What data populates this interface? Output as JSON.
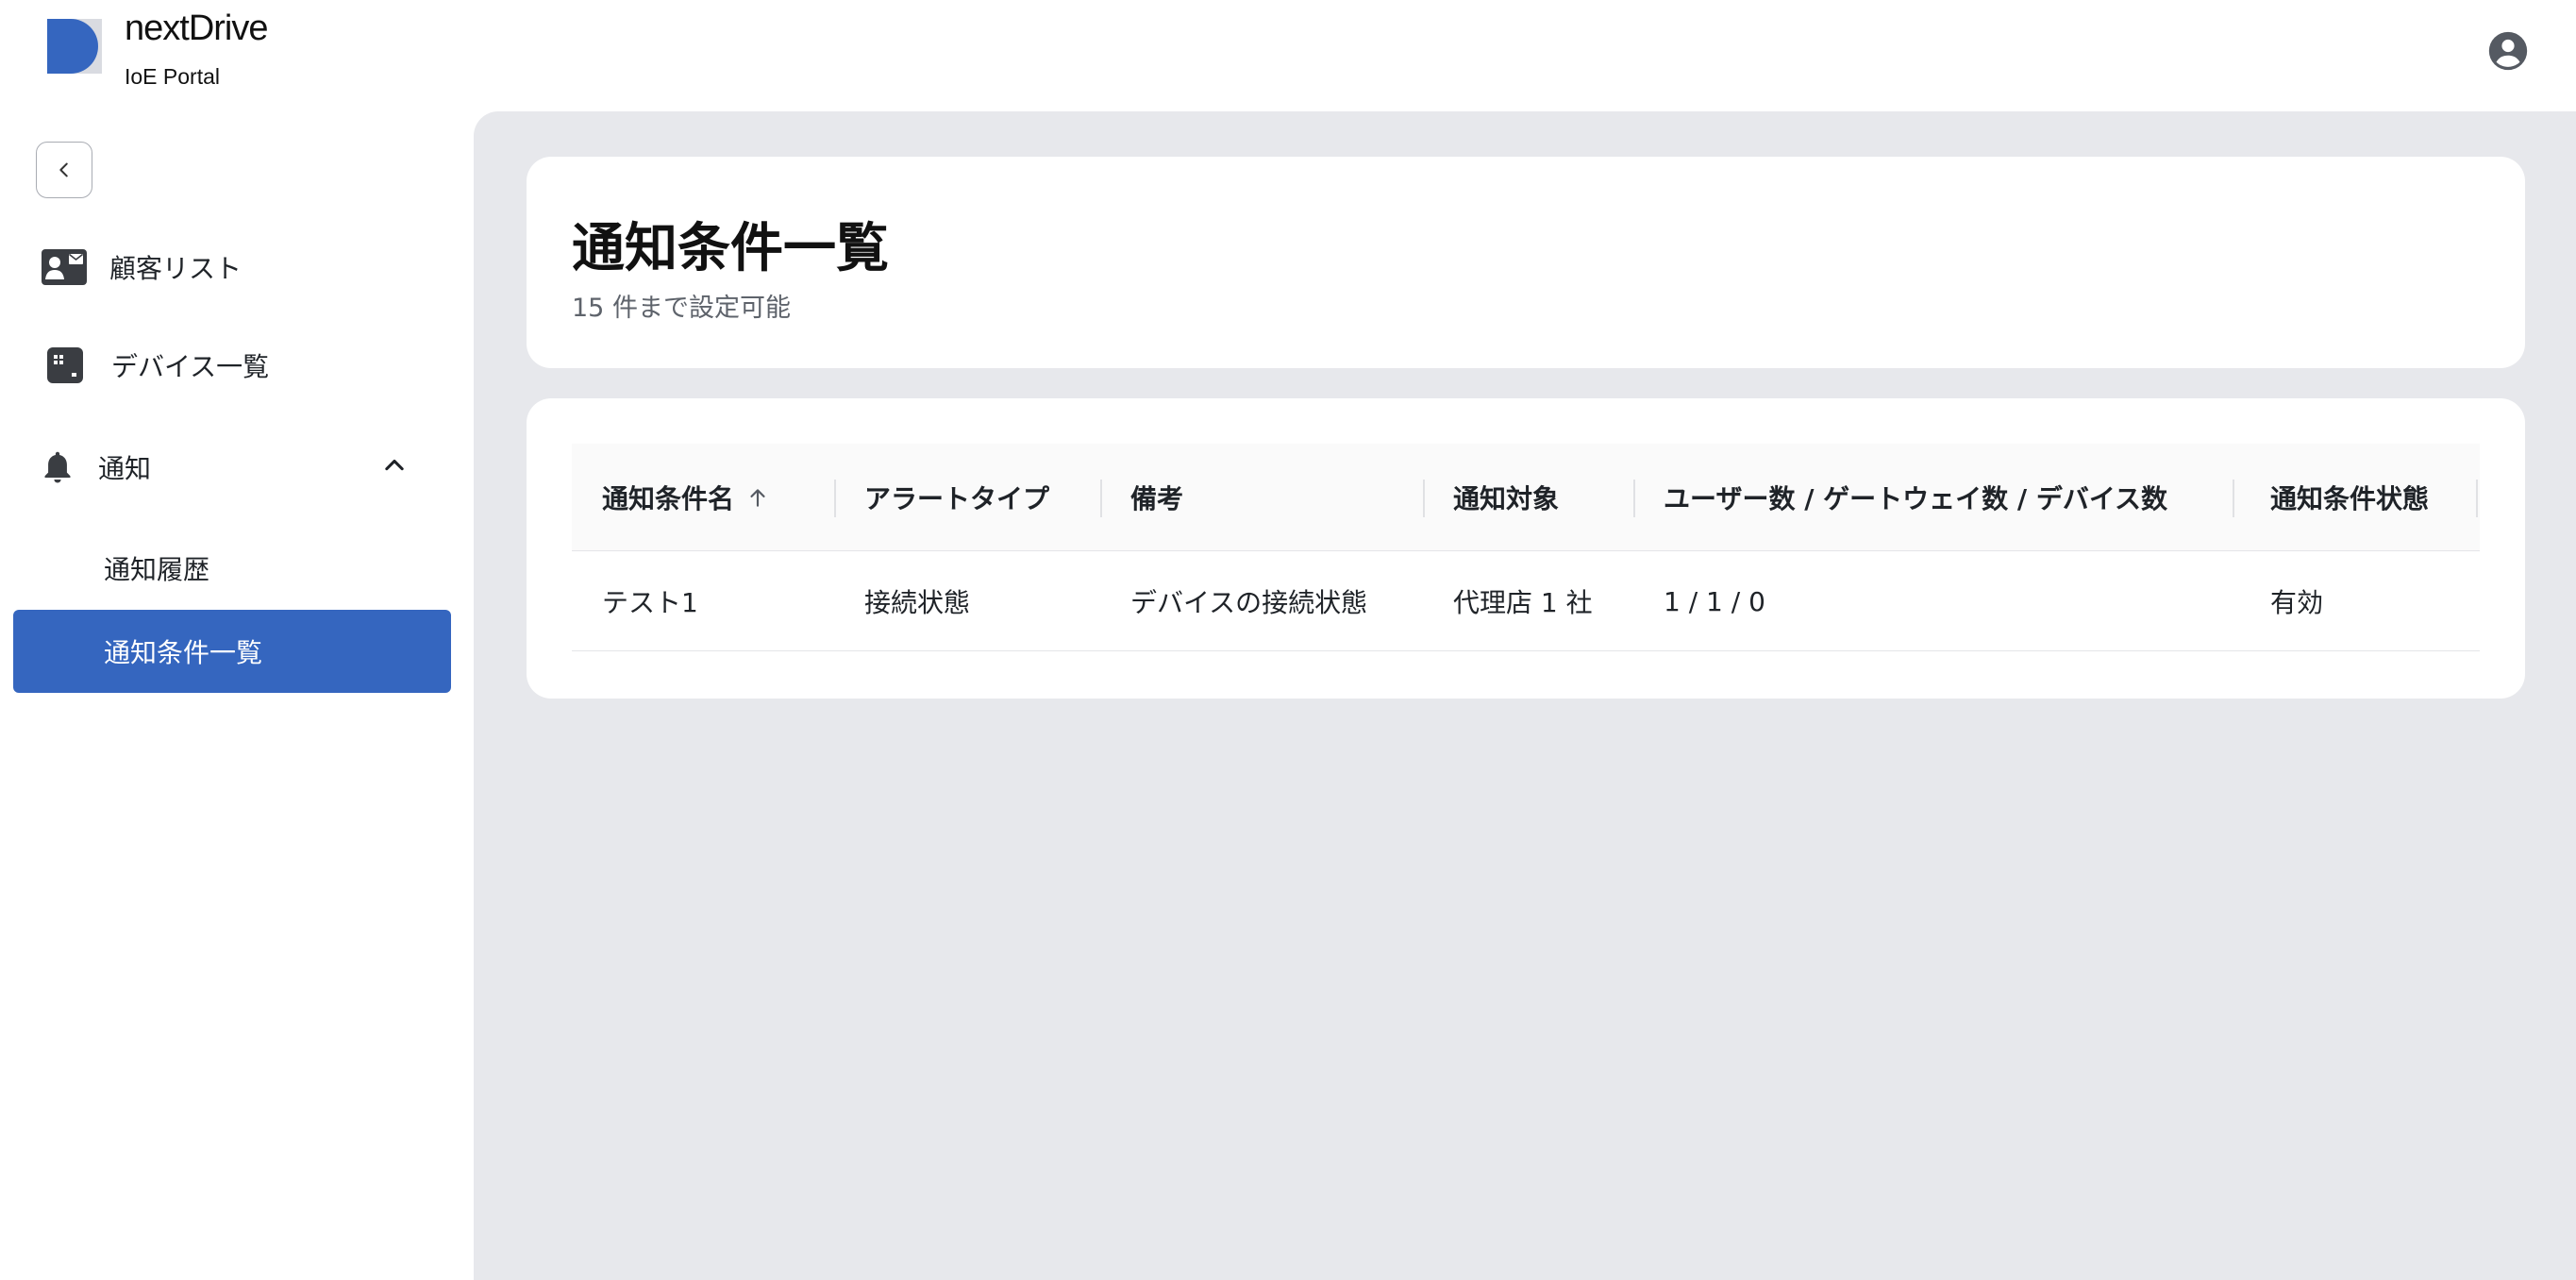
{
  "header": {
    "brand": "nextDrive",
    "product": "IoE Portal",
    "account_icon": "account-circle-icon"
  },
  "sidebar": {
    "collapse_icon": "chevron-left-icon",
    "items": [
      {
        "label": "顧客リスト",
        "icon": "contact-card-icon"
      },
      {
        "label": "デバイス一覧",
        "icon": "device-icon"
      },
      {
        "label": "通知",
        "icon": "bell-icon",
        "expanded": true
      }
    ],
    "subitems": [
      {
        "label": "通知履歴",
        "active": false
      },
      {
        "label": "通知条件一覧",
        "active": true
      }
    ]
  },
  "page": {
    "title": "通知条件一覧",
    "subtitle": "15 件まで設定可能"
  },
  "table": {
    "columns": [
      "通知条件名",
      "アラートタイプ",
      "備考",
      "通知対象",
      "ユーザー数 / ゲートウェイ数 / デバイス数",
      "通知条件状態"
    ],
    "sort_column": "通知条件名",
    "sort_direction": "ascending",
    "rows": [
      [
        "テスト1",
        "接続状態",
        "デバイスの接続状態",
        "代理店 1 社",
        "1 / 1 / 0",
        "有効"
      ]
    ]
  },
  "colors": {
    "accent": "#3566bf",
    "background": "#e7e8ec",
    "card": "#ffffff"
  }
}
